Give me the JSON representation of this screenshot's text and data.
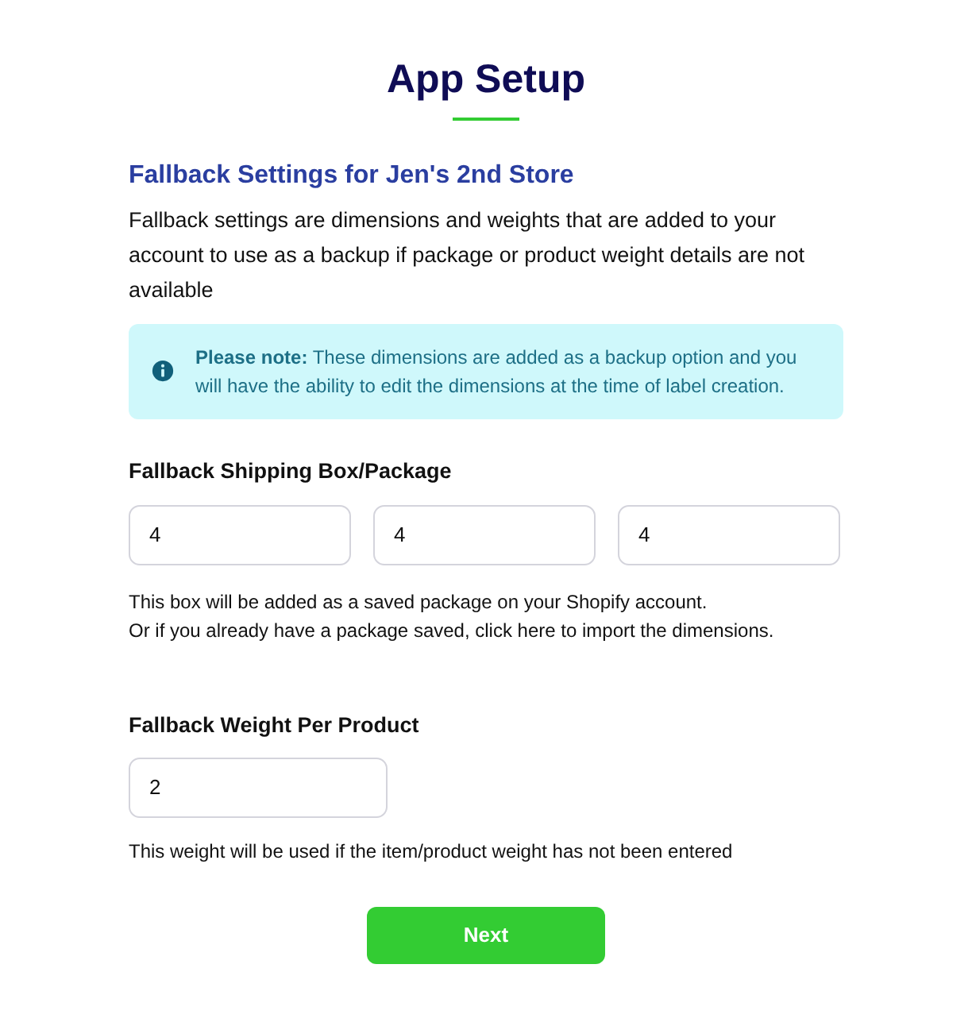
{
  "title": "App Setup",
  "section_title": "Fallback Settings for Jen's 2nd Store",
  "intro": "Fallback settings are dimensions and weights that are added to your account to use as a backup if package or product weight details are not available",
  "note": {
    "text": "**Please note:** These dimensions are added as a backup option and you will have the ability to edit the dimensions at the time of label creation."
  },
  "box": {
    "label": "Fallback Shipping Box/Package",
    "values": [
      "4",
      "4",
      "4"
    ],
    "help": [
      "This box will be added as a saved package on your Shopify account.",
      "Or if you already have a package saved, click here to import the dimensions."
    ]
  },
  "weight": {
    "label": "Fallback Weight Per Product",
    "value": "2",
    "help": "This weight will be used if the item/product weight has not been entered"
  },
  "button": "Next"
}
